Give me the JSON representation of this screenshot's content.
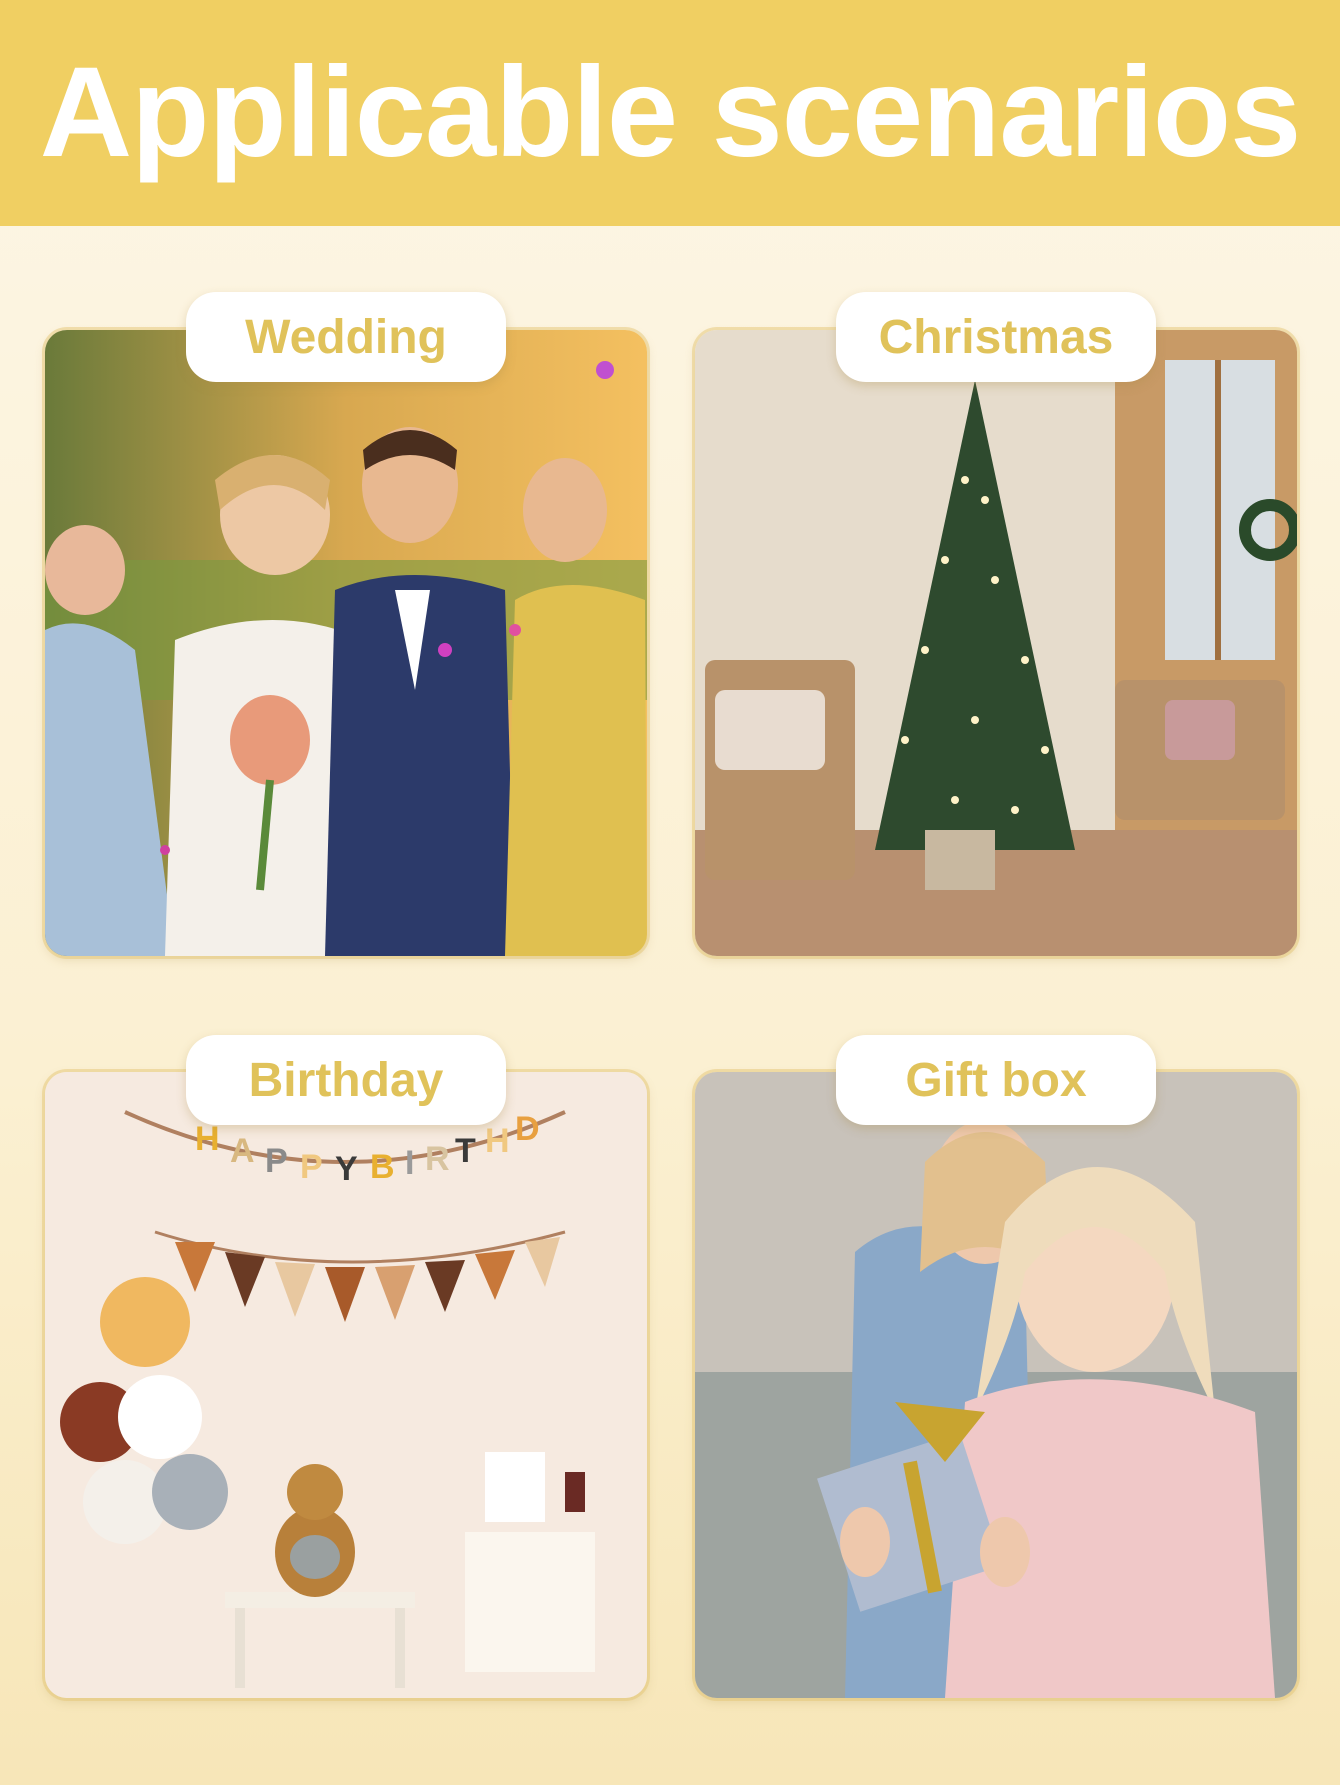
{
  "header": {
    "title": "Applicable scenarios"
  },
  "scenarios": [
    {
      "label": "Wedding"
    },
    {
      "label": "Christmas"
    },
    {
      "label": "Birthday"
    },
    {
      "label": "Gift box"
    }
  ],
  "colors": {
    "banner": "#f0cf62",
    "label_text": "#e0c25a",
    "background": "#fbf0d2"
  }
}
